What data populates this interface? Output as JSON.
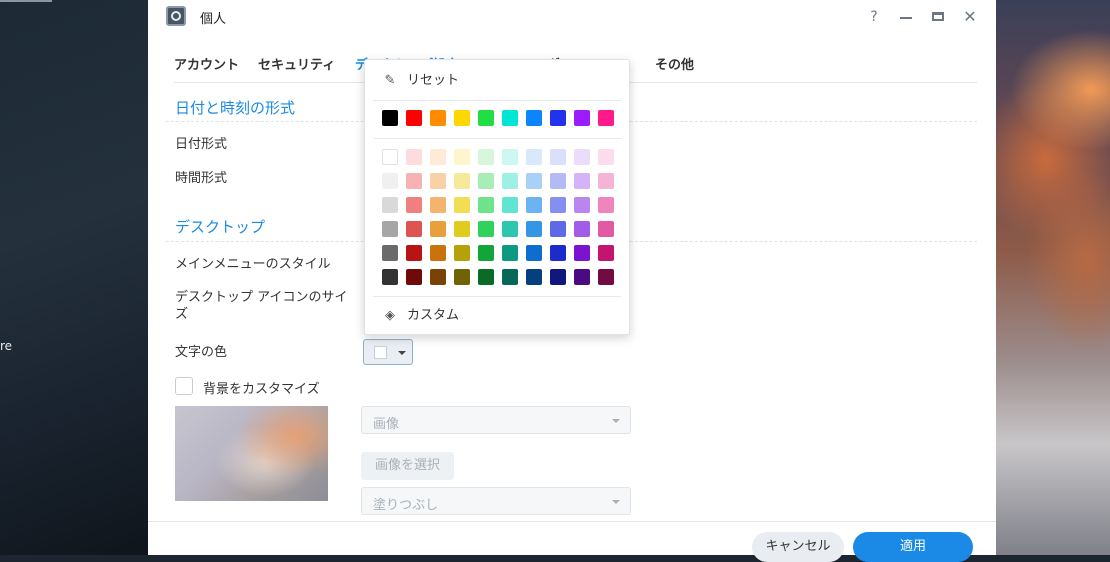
{
  "desktop": {
    "edge_text": "re"
  },
  "window": {
    "title": "個人",
    "controls": {
      "help": "?",
      "close": "✕"
    }
  },
  "tabs": [
    "アカウント",
    "セキュリティ",
    "デスクトップ設定",
    "ログ",
    "その他"
  ],
  "sections": {
    "datetime": {
      "heading": "日付と時刻の形式",
      "date_format_label": "日付形式",
      "time_format_label": "時間形式"
    },
    "desktop": {
      "heading": "デスクトップ",
      "main_menu_style_label": "メインメニューのスタイル",
      "icon_size_label": "デスクトップ アイコンのサイズ",
      "text_color_label": "文字の色",
      "customize_bg_label": "背景をカスタマイズ",
      "customize_bg_checked": false,
      "image_select": {
        "value": "画像"
      },
      "choose_image_button": "画像を選択",
      "fill_select": {
        "value": "塗りつぶし"
      }
    }
  },
  "footer": {
    "cancel": "キャンセル",
    "apply": "適用"
  },
  "color_picker": {
    "reset_label": "リセット",
    "custom_label": "カスタム",
    "selected_color": "#ffffff",
    "accent": "#1a8ae6",
    "basic_colors": [
      "#000000",
      "#ff0000",
      "#ff8c00",
      "#ffd700",
      "#22dd44",
      "#00e5d4",
      "#0a84ff",
      "#2233ee",
      "#9b1dff",
      "#ff1a8c"
    ],
    "shade_rows": [
      [
        "#ffffff",
        "#fcdcdc",
        "#fdebd8",
        "#fdf6cc",
        "#d7f6dc",
        "#cff7f2",
        "#d8e9fb",
        "#dcdffa",
        "#ecdcfb",
        "#fbdcec"
      ],
      [
        "#f0f0f0",
        "#f7b3b3",
        "#f9d1a7",
        "#f6ea9a",
        "#a9edb6",
        "#9ef0e4",
        "#a9d0f7",
        "#b3baf4",
        "#d4b3f6",
        "#f5b3d5"
      ],
      [
        "#d9d9d9",
        "#f08080",
        "#f4b46e",
        "#f1de55",
        "#6ee38a",
        "#5fe5d2",
        "#6bb3f2",
        "#858ff0",
        "#bb85f0",
        "#ef85bd"
      ],
      [
        "#a6a6a6",
        "#e05353",
        "#e8a03d",
        "#e0cc1f",
        "#2fd25c",
        "#2cc7ad",
        "#3596e6",
        "#5d69e6",
        "#a25de8",
        "#e25aa6"
      ],
      [
        "#6a6a6a",
        "#b81414",
        "#c9730c",
        "#b5a10a",
        "#12a53a",
        "#0e9a80",
        "#0d6ecf",
        "#1c2bcb",
        "#7a14cf",
        "#c3146f"
      ],
      [
        "#333333",
        "#6e0a0a",
        "#7a4306",
        "#6f6305",
        "#0a6b26",
        "#07685a",
        "#063f7d",
        "#0f187c",
        "#4a0b80",
        "#730b43"
      ]
    ]
  }
}
